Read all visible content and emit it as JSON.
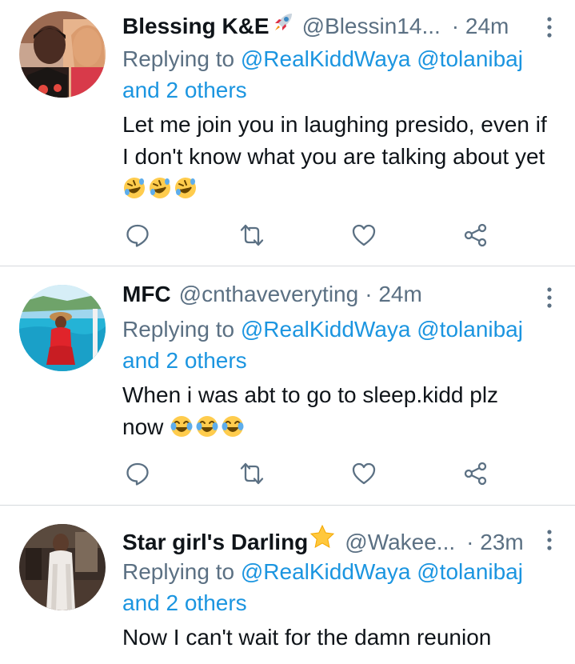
{
  "colors": {
    "link": "#1b95e0",
    "secondary": "#5b7083",
    "text": "#0f1419",
    "divider": "#d6dadd"
  },
  "tweets": [
    {
      "display_name": "Blessing K&E",
      "name_emoji": "rocket-icon",
      "handle": "@Blessin14...",
      "separator": "·",
      "time": "24m",
      "replying_to": "Replying to",
      "mentions": [
        "@RealKiddWaya",
        "@tolanibaj"
      ],
      "others": "and 2 others",
      "text": "Let me join you in laughing presido, even if I don't know what you are talking about yet",
      "emojis": [
        "rolling-laughing-emoji",
        "rolling-laughing-emoji",
        "rolling-laughing-emoji"
      ]
    },
    {
      "display_name": "MFC",
      "name_emoji": "",
      "handle": "@cnthaveveryting",
      "separator": "·",
      "time": "24m",
      "replying_to": "Replying to",
      "mentions": [
        "@RealKiddWaya",
        "@tolanibaj"
      ],
      "others": "and 2 others",
      "text": "When i was abt to go to sleep.kidd plz now",
      "emojis": [
        "tears-of-joy-emoji",
        "tears-of-joy-emoji",
        "tears-of-joy-emoji"
      ]
    },
    {
      "display_name": "Star girl's Darling",
      "name_emoji": "star-icon",
      "handle": "@Wakee...",
      "separator": "·",
      "time": "23m",
      "replying_to": "Replying to",
      "mentions": [
        "@RealKiddWaya",
        "@tolanibaj"
      ],
      "others": "and 2 others",
      "text": "Now I can't wait for the damn reunion",
      "emojis": []
    }
  ]
}
